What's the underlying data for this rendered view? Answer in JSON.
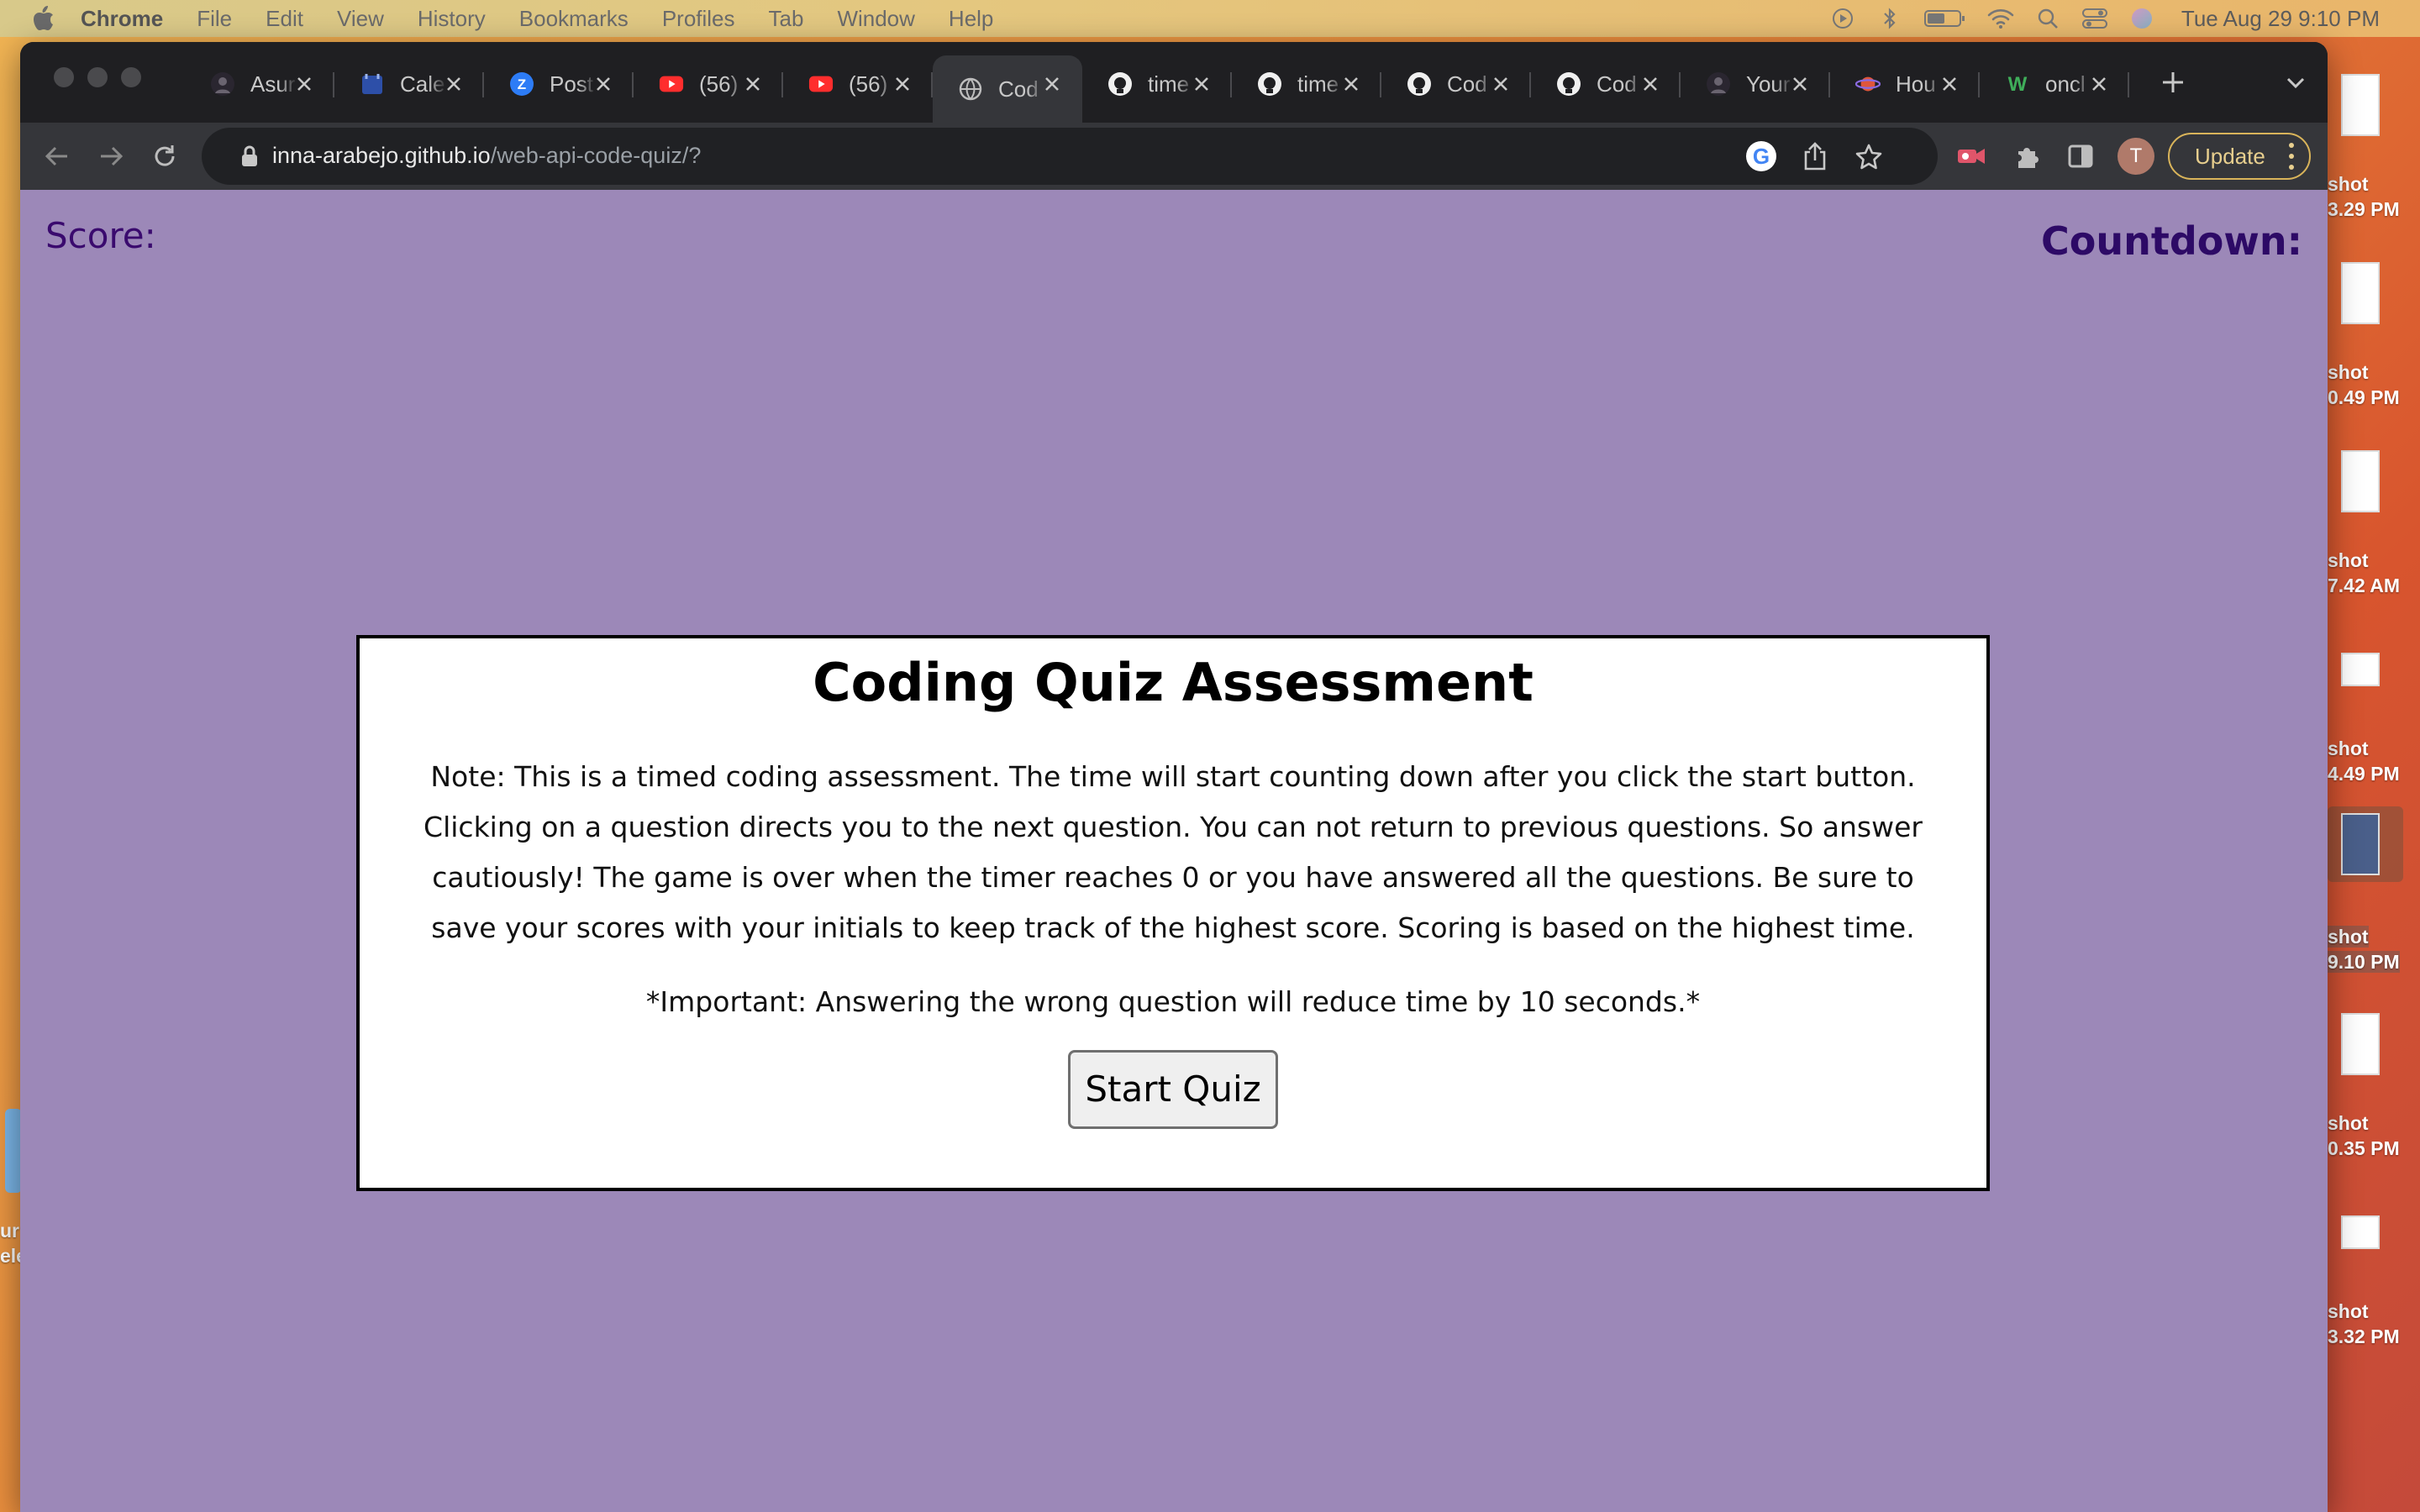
{
  "menubar": {
    "app_name": "Chrome",
    "items": [
      "File",
      "Edit",
      "View",
      "History",
      "Bookmarks",
      "Profiles",
      "Tab",
      "Window",
      "Help"
    ],
    "status_icons": [
      "play-circle-icon",
      "bluetooth-icon",
      "battery-icon",
      "wifi-icon",
      "spotlight-search-icon",
      "control-center-icon",
      "siri-icon"
    ],
    "clock": "Tue Aug 29  9:10 PM"
  },
  "tabs": [
    {
      "title": "Asur",
      "icon": "asurion-icon",
      "active": false
    },
    {
      "title": "Cale",
      "icon": "calendar-icon",
      "active": false
    },
    {
      "title": "Post",
      "icon": "zoom-icon",
      "active": false
    },
    {
      "title": "(56)",
      "icon": "youtube-icon",
      "active": false
    },
    {
      "title": "(56)",
      "icon": "youtube-icon",
      "active": false
    },
    {
      "title": "Cod",
      "icon": "globe-icon",
      "active": true
    },
    {
      "title": "time",
      "icon": "github-icon",
      "active": false
    },
    {
      "title": "time",
      "icon": "github-icon",
      "active": false
    },
    {
      "title": "Cod",
      "icon": "github-icon",
      "active": false
    },
    {
      "title": "Cod",
      "icon": "github-icon",
      "active": false
    },
    {
      "title": "Your",
      "icon": "asurion-icon",
      "active": false
    },
    {
      "title": "Hou",
      "icon": "planet-icon",
      "active": false
    },
    {
      "title": "oncl",
      "icon": "w-icon",
      "active": false
    }
  ],
  "address": {
    "host": "inna-arabejo.github.io",
    "path": "/web-api-code-quiz/?"
  },
  "profile_initial": "T",
  "update_label": "Update",
  "page": {
    "score_label": "Score:",
    "countdown_label": "Countdown:",
    "title": "Coding Quiz Assessment",
    "note": "Note: This is a timed coding assessment. The time will start counting down after you click the start button. Clicking on a question directs you to the next question. You can not return to previous questions. So answer cautiously! The game is over when the timer reaches 0 or you have answered all the questions. Be sure to save your scores with your initials to keep track of the highest score. Scoring is based on the highest time.",
    "important": "*Important: Answering the wrong question will reduce time by 10 seconds.*",
    "start_button": "Start Quiz"
  },
  "desktop_files": [
    {
      "line1": "shot",
      "line2": "3.29 PM"
    },
    {
      "line1": "shot",
      "line2": "0.49 PM"
    },
    {
      "line1": "shot",
      "line2": "7.42 AM"
    },
    {
      "line1": "shot",
      "line2": "4.49 PM"
    },
    {
      "line1": "shot",
      "line2": "9.10 PM"
    },
    {
      "line1": "shot",
      "line2": "0.35 PM"
    },
    {
      "line1": "shot",
      "line2": "3.32 PM"
    }
  ],
  "desktop_left_fragment": [
    "ur",
    "ele"
  ],
  "colors": {
    "page_background": "#9c88b8",
    "score_text": "#3a0a6e",
    "countdown_text": "#2d0a66",
    "card_background": "#ffffff",
    "chrome_dark": "#1f1f22",
    "chrome_toolbar": "#35363a"
  }
}
